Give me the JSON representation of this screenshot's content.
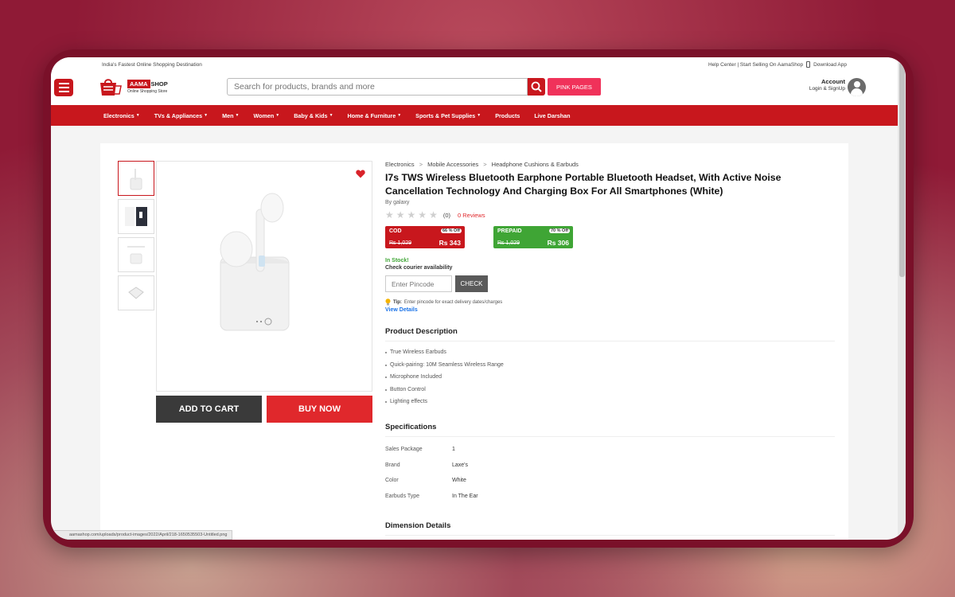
{
  "topstrip": {
    "tagline": "India's Fastest Online Shopping Destination",
    "links": "Help Center | Start Selling On AamaShop",
    "download": "Download App"
  },
  "header": {
    "logo_brand": "AAMA",
    "logo_shop": "SHOP",
    "logo_tagline": "Online Shopping Store",
    "search_placeholder": "Search for products, brands and more",
    "pink_pages_label": "PINK PAGES",
    "account_title": "Account",
    "account_sub": "Login & SignUp"
  },
  "nav": [
    {
      "label": "Electronics",
      "caret": true
    },
    {
      "label": "TVs & Appliances",
      "caret": true
    },
    {
      "label": "Men",
      "caret": true
    },
    {
      "label": "Women",
      "caret": true
    },
    {
      "label": "Baby & Kids",
      "caret": true
    },
    {
      "label": "Home & Furniture",
      "caret": true
    },
    {
      "label": "Sports & Pet Supplies",
      "caret": true
    },
    {
      "label": "Products",
      "caret": false
    },
    {
      "label": "Live Darshan",
      "caret": false
    }
  ],
  "breadcrumb": [
    "Electronics",
    "Mobile Accessories",
    "Headphone Cushions & Earbuds"
  ],
  "breadcrumb_sep": ">",
  "product": {
    "title": "I7s TWS Wireless Bluetooth Earphone Portable Bluetooth Headset, With Active Noise Cancellation Technology And Charging Box For All Smartphones (White)",
    "brand": "By galaxy",
    "rating_count": "(0)",
    "reviews": "0 Reviews",
    "stock": "In Stock!",
    "courier": "Check courier availability",
    "pincode_placeholder": "Enter Pincode",
    "check_label": "CHECK",
    "tip_label": "Tip:",
    "tip_text": "Enter pincode for exact delivery dates/charges",
    "view_details": "View Details",
    "add_to_cart": "ADD TO CART",
    "buy_now": "BUY NOW"
  },
  "prices": {
    "cod": {
      "label": "COD",
      "off": "66 % Off",
      "mrp": "Rs 1,029",
      "price": "Rs 343"
    },
    "prepaid": {
      "label": "PREPAID",
      "off": "70 % Off",
      "mrp": "Rs 1,029",
      "price": "Rs 306"
    }
  },
  "description": {
    "title": "Product Description",
    "items": [
      "True Wireless Earbuds",
      "Quick-pairing: 10M Seamless Wireless Range",
      "Microphone Included",
      "Button Control",
      "Lighting effects"
    ]
  },
  "specifications": {
    "title": "Specifications",
    "rows": [
      {
        "key": "Sales Package",
        "value": "1"
      },
      {
        "key": "Brand",
        "value": "Laxe's"
      },
      {
        "key": "Color",
        "value": "White"
      },
      {
        "key": "Earbuds Type",
        "value": "In The Ear"
      }
    ]
  },
  "dimension_title": "Dimension Details",
  "status_url": "aamashop.com/uploads/product-images/2022/April/218-1650535503-Untitled.png",
  "colors": {
    "brand_red": "#c8171d",
    "pink": "#f0325a",
    "green": "#3fa535",
    "link_blue": "#1a73e8"
  },
  "icons": {
    "menu": "hamburger-icon",
    "search": "search-icon",
    "wishlist": "heart-icon",
    "account": "user-icon",
    "star": "star-icon",
    "tip": "bulb-icon",
    "phone": "phone-icon"
  }
}
